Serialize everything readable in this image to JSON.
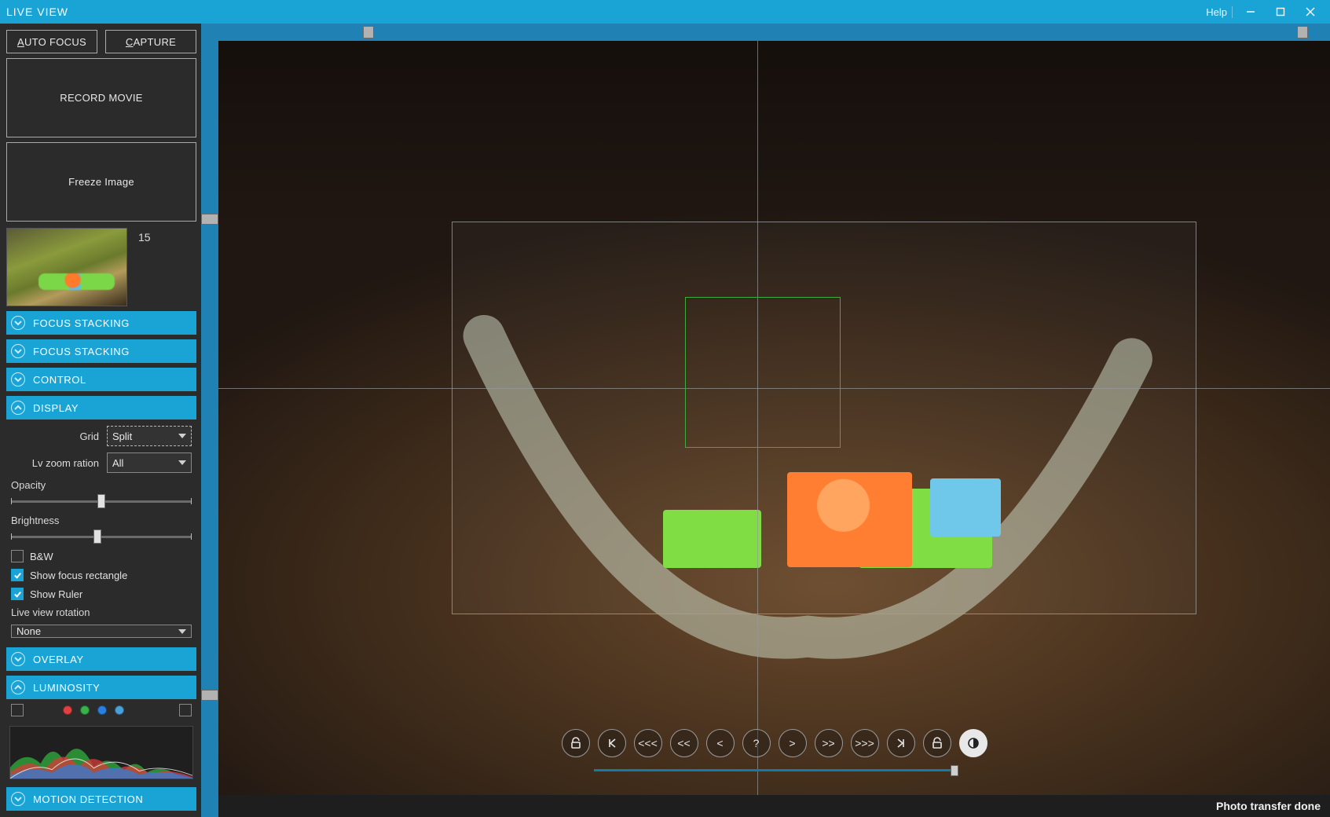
{
  "titlebar": {
    "title": "LIVE VIEW",
    "help": "Help"
  },
  "sidebar": {
    "auto_focus": "AUTO FOCUS",
    "capture": "CAPTURE",
    "record_movie": "RECORD MOVIE",
    "freeze_image": "Freeze Image",
    "thumb_count": "15"
  },
  "panels": {
    "focus_stacking_1": "FOCUS STACKING",
    "focus_stacking_2": "FOCUS STACKING",
    "control": "CONTROL",
    "display": "DISPLAY",
    "overlay": "OVERLAY",
    "luminosity": "LUMINOSITY",
    "motion_detection": "MOTION DETECTION"
  },
  "display": {
    "grid_label": "Grid",
    "grid_value": "Split",
    "zoom_label": "Lv zoom ration",
    "zoom_value": "All",
    "opacity_label": "Opacity",
    "opacity_percent": 50,
    "brightness_label": "Brightness",
    "brightness_percent": 48,
    "bw_label": "B&W",
    "bw_checked": false,
    "show_focus_label": "Show focus rectangle",
    "show_focus_checked": true,
    "show_ruler_label": "Show Ruler",
    "show_ruler_checked": true,
    "rotation_label": "Live view rotation",
    "rotation_value": "None"
  },
  "ruler": {
    "h_marker_a_percent": 13,
    "h_marker_b_percent": 97,
    "v_marker_a_percent": 24,
    "v_marker_b_percent": 84
  },
  "focus_controls": {
    "lock_left": "lock-open",
    "first": "|<",
    "back3": "<<<",
    "back2": "<<",
    "back1": "<",
    "query": "?",
    "fwd1": ">",
    "fwd2": ">>",
    "fwd3": ">>>",
    "last": ">|",
    "lock_right": "lock-open",
    "contrast": "contrast"
  },
  "progress_percent": 100,
  "status": "Photo transfer done"
}
